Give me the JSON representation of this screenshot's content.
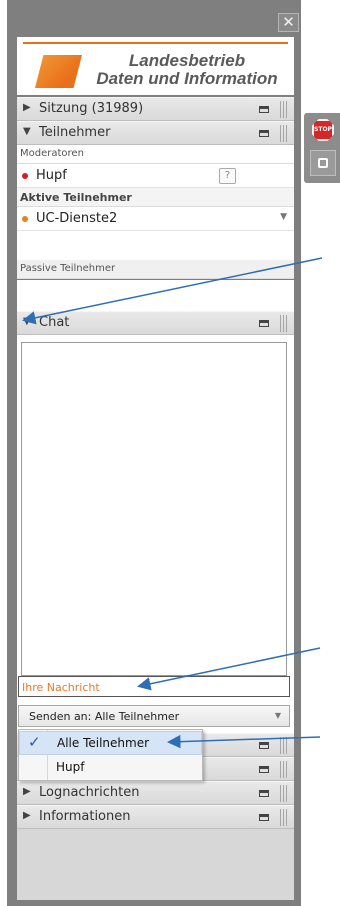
{
  "window": {
    "close_glyph": "✕"
  },
  "logo": {
    "line1": "Landesbetrieb",
    "line2": "Daten und Information"
  },
  "sections": {
    "sitzung": {
      "label": "Sitzung (31989)",
      "expanded": false
    },
    "teilnehmer": {
      "label": "Teilnehmer",
      "expanded": true
    },
    "chat": {
      "label": "Chat",
      "expanded": true
    },
    "lognachrichten": {
      "label": "Lognachrichten",
      "expanded": false
    },
    "informationen": {
      "label": "Informationen",
      "expanded": false
    }
  },
  "participants": {
    "moderators_label": "Moderatoren",
    "moderator": {
      "name": "Hupf",
      "help_glyph": "?",
      "status_color": "#d9192c"
    },
    "active_label": "Aktive Teilnehmer",
    "active": {
      "name": "UC-Dienste2",
      "status_color": "#ef7d1a"
    },
    "passive_label": "Passive Teilnehmer"
  },
  "chat": {
    "message_placeholder": "Ihre Nachricht",
    "send_to_label": "Senden an: Alle Teilnehmer",
    "recipient_options": [
      {
        "label": "Alle Teilnehmer",
        "selected": true
      },
      {
        "label": "Hupf",
        "selected": false
      }
    ]
  },
  "side_controls": {
    "stop_label": "STOP"
  },
  "colors": {
    "accent": "#ef7d1a",
    "panel": "#7f7f7f",
    "annotation_arrow": "#2e6eb5"
  }
}
